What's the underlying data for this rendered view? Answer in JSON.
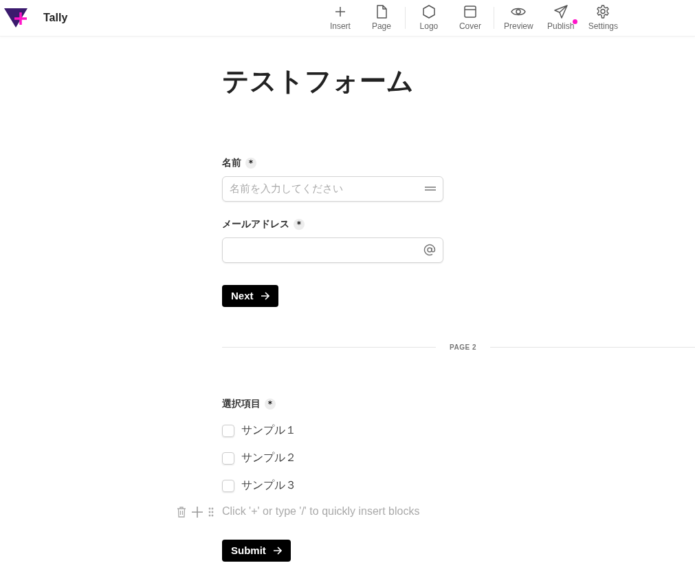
{
  "app": {
    "name": "Tally"
  },
  "toolbar": [
    {
      "items": [
        {
          "label": "Insert",
          "kind": "plus",
          "badge": false
        },
        {
          "label": "Page",
          "kind": "page",
          "badge": false
        }
      ]
    },
    {
      "items": [
        {
          "label": "Logo",
          "kind": "hexagon",
          "badge": false
        },
        {
          "label": "Cover",
          "kind": "cover",
          "badge": false
        }
      ]
    },
    {
      "items": [
        {
          "label": "Preview",
          "kind": "eye",
          "badge": false
        },
        {
          "label": "Publish",
          "kind": "send",
          "badge": true
        },
        {
          "label": "Settings",
          "kind": "gear",
          "badge": false
        }
      ]
    }
  ],
  "form": {
    "title": "テストフォーム",
    "page1": [
      {
        "kind": "text",
        "label": "名前",
        "required_mark": "*",
        "placeholder": "名前を入力してください"
      },
      {
        "kind": "email",
        "label": "メールアドレス",
        "required_mark": "*"
      }
    ],
    "next_button": "Next",
    "page_break": "PAGE 2",
    "page2": {
      "label": "選択項目",
      "required_mark": "*",
      "options": [
        {
          "label": "サンプル１",
          "checked": false
        },
        {
          "label": "サンプル２",
          "checked": false
        },
        {
          "label": "サンプル３",
          "checked": false
        }
      ]
    },
    "insert_hint": "Click '+' or type '/' to quickly insert blocks",
    "submit_button": "Submit"
  }
}
